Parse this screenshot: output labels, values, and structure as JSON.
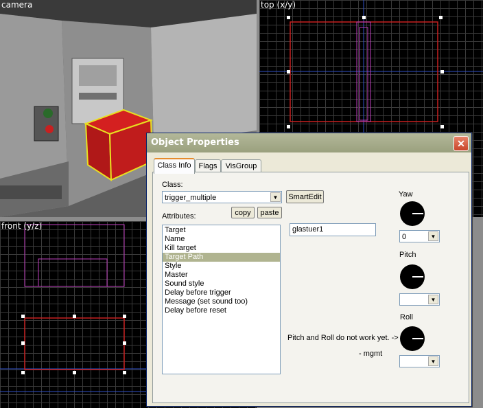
{
  "viewports": {
    "camera": "camera",
    "top": "top (x/y)",
    "front": "front (y/z)"
  },
  "dialog": {
    "title": "Object Properties",
    "close_label": "✕",
    "tabs": [
      {
        "label": "Class Info"
      },
      {
        "label": "Flags"
      },
      {
        "label": "VisGroup"
      }
    ],
    "class_label": "Class:",
    "class_value": "trigger_multiple",
    "smartedit_label": "SmartEdit",
    "attributes_label": "Attributes:",
    "copy_label": "copy",
    "paste_label": "paste",
    "attributes": [
      "Target",
      "Name",
      "Kill target",
      "Target Path",
      "Style",
      "Master",
      "Sound style",
      "Delay before trigger",
      "Message (set sound too)",
      "Delay before reset"
    ],
    "selected_attribute": "Target Path",
    "value": "glastuer1",
    "yaw_label": "Yaw",
    "yaw_value": "0",
    "pitch_label": "Pitch",
    "pitch_value": "",
    "roll_label": "Roll",
    "roll_value": "",
    "note": "Pitch and Roll do not work yet. ->",
    "signature": "- mgmt"
  }
}
